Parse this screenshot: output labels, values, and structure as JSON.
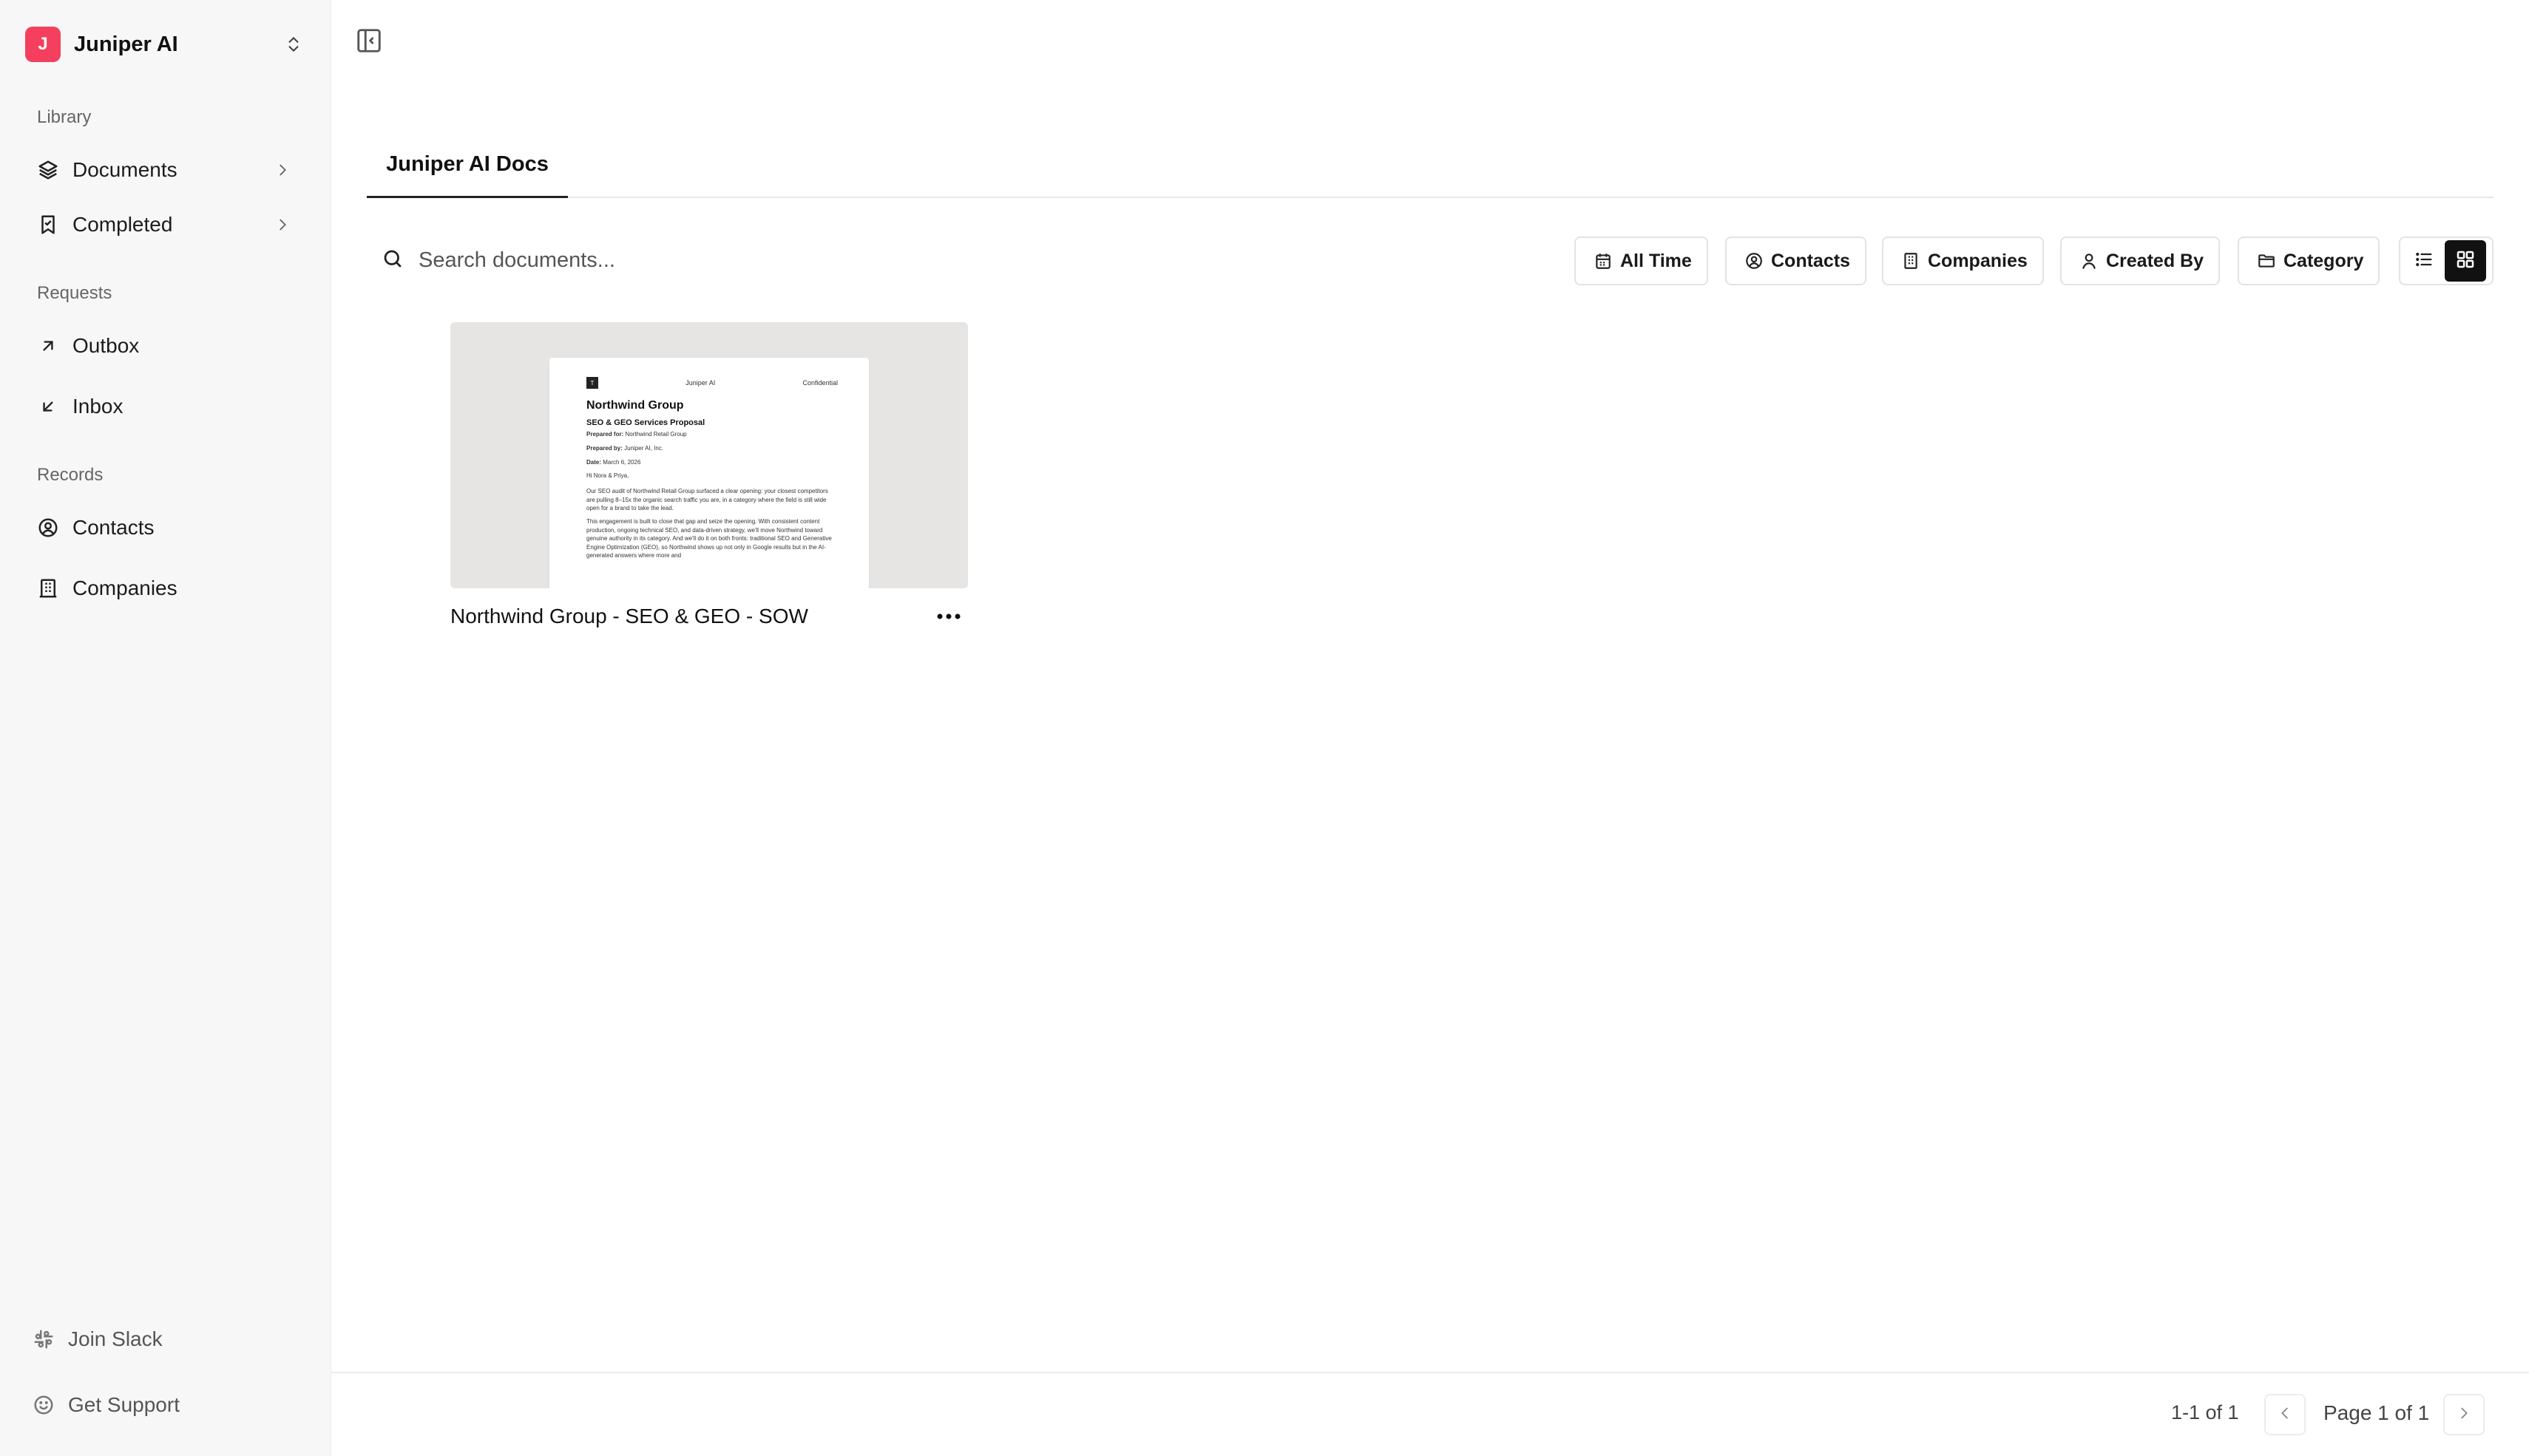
{
  "workspace": {
    "initial": "J",
    "name": "Juniper AI"
  },
  "sidebar": {
    "sections": [
      {
        "label": "Library"
      },
      {
        "label": "Requests"
      },
      {
        "label": "Records"
      }
    ],
    "items": [
      {
        "label": "Documents",
        "icon": "layers-icon"
      },
      {
        "label": "Completed",
        "icon": "bookmark-check-icon"
      },
      {
        "label": "Outbox",
        "icon": "arrow-up-right-icon"
      },
      {
        "label": "Inbox",
        "icon": "arrow-down-left-icon"
      },
      {
        "label": "Contacts",
        "icon": "user-circle-icon"
      },
      {
        "label": "Companies",
        "icon": "building-icon"
      }
    ],
    "footer": [
      {
        "label": "Join Slack",
        "icon": "slack-icon"
      },
      {
        "label": "Get Support",
        "icon": "smile-icon"
      }
    ]
  },
  "main": {
    "tabs": [
      {
        "label": "Juniper AI Docs"
      }
    ],
    "search": {
      "placeholder": "Search documents...",
      "value": ""
    },
    "filters": [
      {
        "label": "All Time",
        "icon": "calendar-icon"
      },
      {
        "label": "Contacts",
        "icon": "user-circle-icon"
      },
      {
        "label": "Companies",
        "icon": "building-icon"
      },
      {
        "label": "Created By",
        "icon": "user-icon"
      },
      {
        "label": "Category",
        "icon": "folder-icon"
      }
    ],
    "view": {
      "active": "grid"
    },
    "documents": [
      {
        "title": "Northwind Group - SEO & GEO - SOW",
        "preview": {
          "mark": "T",
          "company": "Juniper AI",
          "confidential": "Confidential",
          "heading": "Northwind Group",
          "subheading": "SEO & GEO Services Proposal",
          "prepared_for_label": "Prepared for:",
          "prepared_for": "Northwind Retail Group",
          "prepared_by_label": "Prepared by:",
          "prepared_by": "Juniper AI, Inc.",
          "date_label": "Date:",
          "date": "March 6, 2026",
          "greeting": "Hi Nora & Priya,",
          "para1": "Our SEO audit of Northwind Retail Group surfaced a clear opening: your closest competitors are pulling 8–15x the organic search traffic you are, in a category where the field is still wide open for a brand to take the lead.",
          "para2": "This engagement is built to close that gap and seize the opening. With consistent content production, ongoing technical SEO, and data-driven strategy, we'll move Northwind toward genuine authority in its category. And we'll do it on both fronts: traditional SEO and Generative Engine Optimization (GEO), so Northwind shows up not only in Google results but in the AI-generated answers where more and"
        }
      }
    ]
  },
  "pagination": {
    "range": "1-1 of 1",
    "page": "Page 1 of 1"
  },
  "colors": {
    "brand": "#f43f5e",
    "active_toggle": "#111111"
  }
}
